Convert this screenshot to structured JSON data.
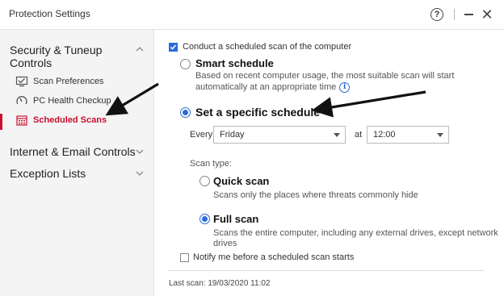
{
  "window": {
    "title": "Protection Settings",
    "help_label": "?",
    "close_label": "✕"
  },
  "sidebar": {
    "sections": [
      {
        "label": "Security & Tuneup Controls",
        "items": [
          {
            "label": "Scan Preferences",
            "icon": "scan-preferences-icon",
            "active": false
          },
          {
            "label": "PC Health Checkup",
            "icon": "gauge-icon",
            "active": false
          },
          {
            "label": "Scheduled Scans",
            "icon": "calendar-icon",
            "active": true
          }
        ]
      },
      {
        "label": "Internet & Email Controls"
      },
      {
        "label": "Exception Lists"
      }
    ],
    "accent_color": "#c8102e"
  },
  "main": {
    "conduct_scan": {
      "label": "Conduct a scheduled scan of the computer",
      "checked": true
    },
    "smart_schedule": {
      "label": "Smart schedule",
      "desc_line1": "Based on recent computer usage, the most suitable scan will start",
      "desc_line2": "automatically at an appropriate time",
      "selected": false
    },
    "specific_schedule": {
      "label": "Set a specific schedule",
      "selected": true,
      "every_label": "Every",
      "day_value": "Friday",
      "at_label": "at",
      "time_value": "12:00"
    },
    "scan_type": {
      "heading": "Scan type:",
      "quick": {
        "label": "Quick scan",
        "desc": "Scans only the places where threats commonly hide",
        "selected": false
      },
      "full": {
        "label": "Full scan",
        "desc_line1": "Scans the entire computer, including any external drives, except network",
        "desc_line2": "drives",
        "selected": true
      }
    },
    "notify": {
      "label": "Notify me before a scheduled scan starts",
      "checked": false
    },
    "last_scan": "Last scan: 19/03/2020 11:02",
    "accent_color": "#2b6cd4"
  }
}
